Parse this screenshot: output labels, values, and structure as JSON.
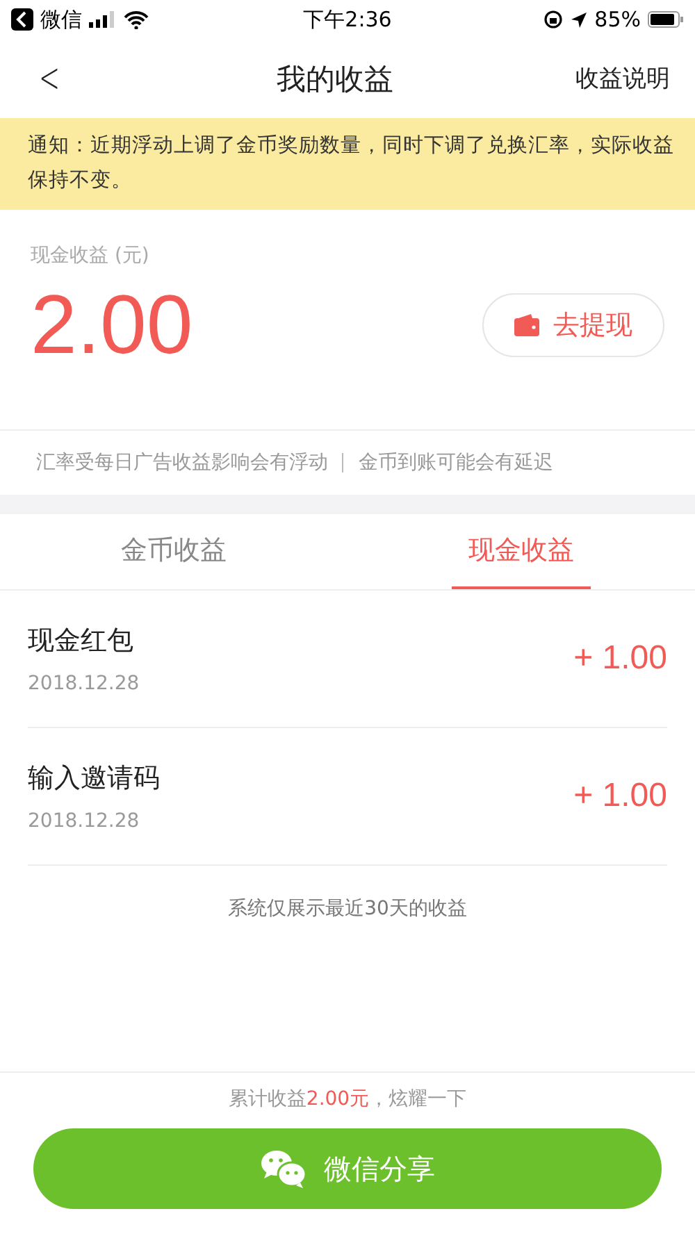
{
  "status_bar": {
    "back_app": "微信",
    "time": "下午2:36",
    "battery": "85%"
  },
  "nav": {
    "back": "<",
    "title": "我的收益",
    "action": "收益说明"
  },
  "notice": "通知：近期浮动上调了金币奖励数量，同时下调了兑换汇率，实际收益保持不变。",
  "earnings": {
    "label": "现金收益 (元)",
    "amount": "2.00",
    "withdraw": "去提现"
  },
  "tips": [
    "汇率受每日广告收益影响会有浮动",
    "金币到账可能会有延迟"
  ],
  "tabs": [
    {
      "label": "金币收益",
      "selected": false
    },
    {
      "label": "现金收益",
      "selected": true
    }
  ],
  "records": [
    {
      "title": "现金红包",
      "date": "2018.12.28",
      "amount": "+ 1.00"
    },
    {
      "title": "输入邀请码",
      "date": "2018.12.28",
      "amount": "+ 1.00"
    }
  ],
  "list_note": "系统仅展示最近30天的收益",
  "summary": {
    "before": "累计收益",
    "amount": "2.00元",
    "after": "，炫耀一下"
  },
  "share_button": "微信分享"
}
